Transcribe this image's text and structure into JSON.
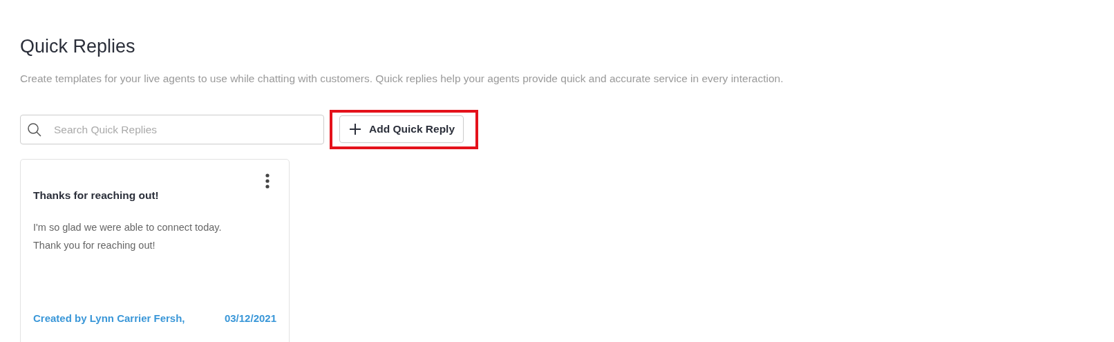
{
  "page": {
    "title": "Quick Replies",
    "description": "Create templates for your live agents to use while chatting with customers. Quick replies help your agents provide quick and accurate service in every interaction."
  },
  "search": {
    "placeholder": "Search Quick Replies"
  },
  "add_button": {
    "label": "Add Quick Reply",
    "highlighted": true
  },
  "cards": [
    {
      "title": "Thanks for reaching out!",
      "body_lines": [
        "I'm so glad we were able to connect today.",
        "Thank you for reaching out!"
      ],
      "created_by": "Created by Lynn Carrier Fersh,",
      "date": "03/12/2021"
    }
  ]
}
